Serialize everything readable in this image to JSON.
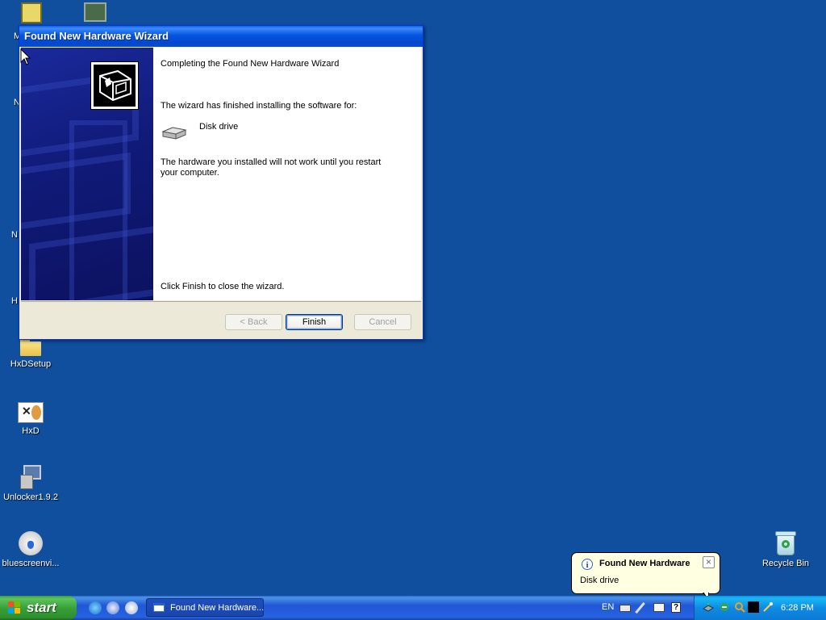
{
  "desktop": {
    "icons": [
      {
        "label": ""
      },
      {
        "label": ""
      },
      {
        "label": "HxDSetup"
      },
      {
        "label": "HxD"
      },
      {
        "label": "Unlocker1.9.2"
      },
      {
        "label": "bluescreenvi..."
      },
      {
        "label": "Recycle Bin"
      }
    ],
    "partial_labels": [
      "M",
      "N",
      "N",
      "H"
    ]
  },
  "wizard": {
    "title": "Found New Hardware Wizard",
    "heading": "Completing the Found New Hardware Wizard",
    "finished_text": "The wizard has finished installing the software for:",
    "device_name": "Disk drive",
    "restart_line1": "The hardware you installed will not work until you restart",
    "restart_line2": "your computer.",
    "finish_hint": "Click Finish to close the wizard.",
    "buttons": {
      "back": "< Back",
      "finish": "Finish",
      "cancel": "Cancel"
    }
  },
  "taskbar": {
    "start_label": "start",
    "task_button": "Found New Hardware...",
    "language": "EN",
    "clock": "6:28 PM"
  },
  "balloon": {
    "title": "Found New Hardware",
    "text": "Disk drive",
    "close_glyph": "×"
  },
  "colors": {
    "desktop": "#0f4f9e",
    "titlebar": "#0555e0",
    "start_green": "#38a138",
    "tray_blue": "#0f8be4"
  }
}
